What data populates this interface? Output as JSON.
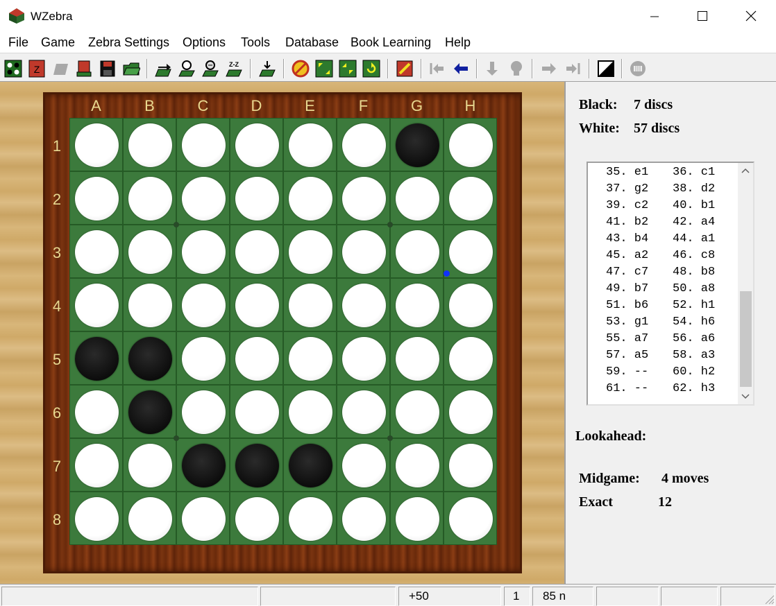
{
  "window": {
    "title": "WZebra"
  },
  "menu": [
    "File",
    "Game",
    "Zebra Settings",
    "Options",
    "Tools",
    "Database",
    "Book Learning",
    "Help"
  ],
  "toolbar_icons": [
    "new-game-icon",
    "zebra-icon",
    "open-gray-icon",
    "open-book-icon",
    "save-icon",
    "folder-icon",
    "move-now-icon",
    "hint-icon",
    "analyze-icon",
    "zz-icon",
    "place-icon",
    "stop-icon",
    "expand-icon",
    "shrink-icon",
    "rotate-icon",
    "edit-icon",
    "first-move-icon",
    "back-icon",
    "down-arrow-icon",
    "bulb-icon",
    "forward-icon",
    "last-move-icon",
    "flip-colors-icon",
    "coin-icon"
  ],
  "board": {
    "columns": [
      "A",
      "B",
      "C",
      "D",
      "E",
      "F",
      "G",
      "H"
    ],
    "rows": [
      "1",
      "2",
      "3",
      "4",
      "5",
      "6",
      "7",
      "8"
    ],
    "cells": [
      "WWWWWWBW",
      "WWWWWWWW",
      "WWWWWWWW",
      "WWWWWWWW",
      "BBWWWWWW",
      "WBWWWWWW",
      "WWBBBWWW",
      "WWWWWWWW"
    ],
    "colors": {
      "board": "#3c7a3c",
      "white": "#ffffff",
      "black": "#111111",
      "last_move_marker": "#1030ff"
    }
  },
  "stats": {
    "black_label": "Black:",
    "black_value": "7 discs",
    "white_label": "White:",
    "white_value": "57 discs"
  },
  "moves": [
    [
      "35. e1",
      "36. c1"
    ],
    [
      "37. g2",
      "38. d2"
    ],
    [
      "39. c2",
      "40. b1"
    ],
    [
      "41. b2",
      "42. a4"
    ],
    [
      "43. b4",
      "44. a1"
    ],
    [
      "45. a2",
      "46. c8"
    ],
    [
      "47. c7",
      "48. b8"
    ],
    [
      "49. b7",
      "50. a8"
    ],
    [
      "51. b6",
      "52. h1"
    ],
    [
      "53. g1",
      "54. h6"
    ],
    [
      "55. a7",
      "56. a6"
    ],
    [
      "57. a5",
      "58. a3"
    ],
    [
      "59. --",
      "60. h2"
    ],
    [
      "61. --",
      "62. h3"
    ]
  ],
  "lookahead": {
    "label": "Lookahead:",
    "midgame_label": "Midgame:",
    "midgame_value": "4 moves",
    "exact_label": "Exact",
    "exact_value": "12"
  },
  "status": {
    "pane1": "",
    "pane2": "",
    "score": "+50",
    "count": "1",
    "nodes": "85 n",
    "pane6": "",
    "pane7": "",
    "pane8": ""
  }
}
